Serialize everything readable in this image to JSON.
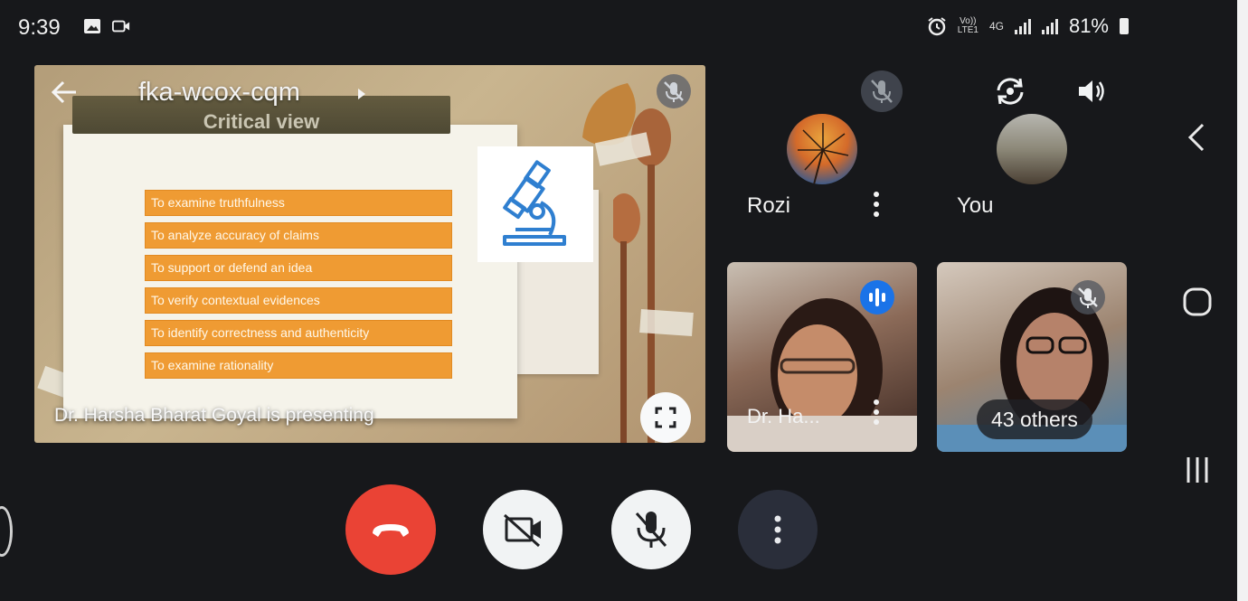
{
  "status_bar": {
    "time": "9:39",
    "network_top": "Vo))",
    "network_bottom": "LTE1",
    "lte_label": "4G",
    "battery_text": "81%"
  },
  "presentation": {
    "meeting_code": "fka-wcox-cqm",
    "slide_title": "Critical view",
    "slide_items": [
      "To examine truthfulness",
      "To analyze accuracy of claims",
      "To support or defend an idea",
      "To verify contextual evidences",
      "To identify correctness and authenticity",
      "To examine rationality"
    ],
    "presenting_text": "Dr. Harsha Bharat Goyal is presenting"
  },
  "participants": {
    "rozi_name": "Rozi",
    "you_name": "You",
    "dr_name": "Dr. Ha...",
    "others_label": "43 others"
  },
  "colors": {
    "end_call": "#ea4335",
    "slide_item_bg": "#ef9b33",
    "speaking_blue": "#1a73e8",
    "microscope_blue": "#2f7fd0"
  }
}
